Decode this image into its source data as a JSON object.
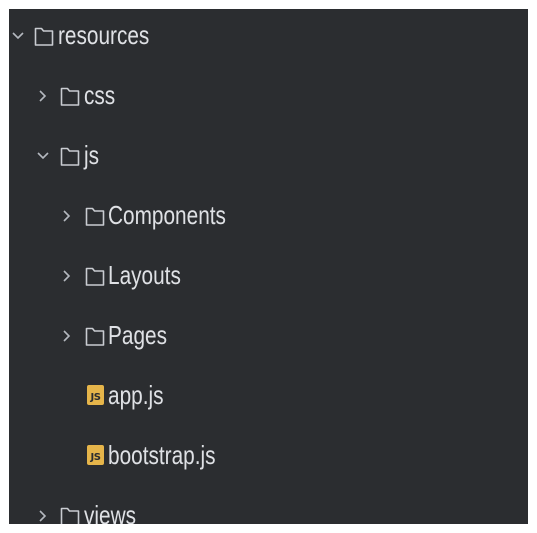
{
  "tree": {
    "items": [
      {
        "label": "resources",
        "type": "folder",
        "depth": 0,
        "state": "expanded"
      },
      {
        "label": "css",
        "type": "folder",
        "depth": 1,
        "state": "collapsed"
      },
      {
        "label": "js",
        "type": "folder",
        "depth": 1,
        "state": "expanded"
      },
      {
        "label": "Components",
        "type": "folder",
        "depth": 2,
        "state": "collapsed"
      },
      {
        "label": "Layouts",
        "type": "folder",
        "depth": 2,
        "state": "collapsed"
      },
      {
        "label": "Pages",
        "type": "folder",
        "depth": 2,
        "state": "collapsed"
      },
      {
        "label": "app.js",
        "type": "js-file",
        "depth": 2,
        "badge": "JS"
      },
      {
        "label": "bootstrap.js",
        "type": "js-file",
        "depth": 2,
        "badge": "JS"
      },
      {
        "label": "views",
        "type": "folder",
        "depth": 1,
        "state": "collapsed"
      }
    ]
  },
  "colors": {
    "background": "#2b2d30",
    "text": "#dfe1e5",
    "chevron": "#b4b8bf",
    "folder_outline": "#c9ccd1",
    "js_badge": "#e6b54a"
  },
  "icons": {
    "expanded": "chevron-down-icon",
    "collapsed": "chevron-right-icon",
    "folder": "folder-icon",
    "js_file": "js-file-icon"
  }
}
